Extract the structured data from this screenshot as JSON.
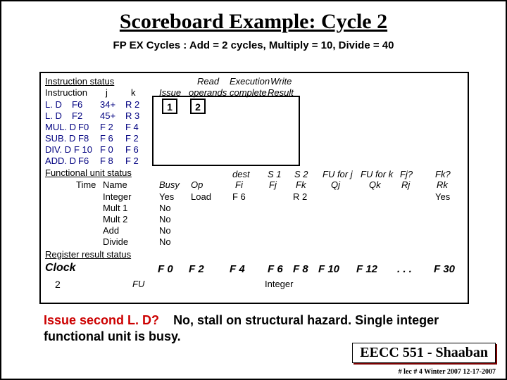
{
  "title": "Scoreboard Example:  Cycle 2",
  "subtitle": "FP EX Cycles :  Add = 2 cycles, Multiply = 10, Divide = 40",
  "labels": {
    "instr_status": "Instruction status",
    "instruction": "Instruction",
    "j": "j",
    "k": "k",
    "issue": "Issue",
    "read": "Read",
    "operands": "operands",
    "execution": "Execution",
    "complete": "complete",
    "write": "Write",
    "result": "Result",
    "func_unit_status": "Functional unit status",
    "time": "Time",
    "name": "Name",
    "busy": "Busy",
    "op": "Op",
    "dest": "dest",
    "fi": "Fi",
    "s1": "S 1",
    "fj": "Fj",
    "s2": "S 2",
    "fk": "Fk",
    "fuj": "FU for j",
    "qj": "Qj",
    "fuk": "FU for k",
    "qk": "Qk",
    "fjq": "Fj?",
    "rj": "Rj",
    "fkq": "Fk?",
    "rk": "Rk",
    "reg_result_status": "Register result status",
    "clock": "Clock",
    "fu": "FU"
  },
  "instr": [
    {
      "op": "L. D",
      "rd": "F6",
      "j": "34+",
      "k": "R 2",
      "issue": "1",
      "read": "2"
    },
    {
      "op": "L. D",
      "rd": "F2",
      "j": "45+",
      "k": "R 3"
    },
    {
      "op": "MUL. D",
      "rd": "F0",
      "j": "F 2",
      "k": "F 4"
    },
    {
      "op": "SUB. D",
      "rd": "F8",
      "j": "F 6",
      "k": "F 2"
    },
    {
      "op": "DIV. D",
      "rd": "F 10",
      "j": "F 0",
      "k": "F 6"
    },
    {
      "op": "ADD. D",
      "rd": "F6",
      "j": "F 8",
      "k": "F 2"
    }
  ],
  "fu": [
    {
      "name": "Integer",
      "busy": "Yes",
      "op": "Load",
      "fi": "F 6",
      "fj": "",
      "fk": "R 2",
      "qj": "",
      "qk": "",
      "rj": "",
      "rk": "Yes"
    },
    {
      "name": "Mult 1",
      "busy": "No"
    },
    {
      "name": "Mult 2",
      "busy": "No"
    },
    {
      "name": "Add",
      "busy": "No"
    },
    {
      "name": "Divide",
      "busy": "No"
    }
  ],
  "clock_val": "2",
  "regs": [
    "F 0",
    "F 2",
    "F 4",
    "F 6",
    "F 8",
    "F 10",
    "F 12",
    ". . .",
    "F 30"
  ],
  "reg_fu": {
    "F 6": "Integer"
  },
  "bottom1": "Issue second L. D?",
  "bottom2": "No, stall on structural hazard.  Single integer functional unit is busy.",
  "course": "EECC 551 - Shaaban",
  "footer": "#  lec # 4  Winter 2007    12-17-2007",
  "chart_data": {
    "type": "table",
    "title": "Scoreboard Example: Cycle 2",
    "constants": {
      "add_cycles": 2,
      "multiply_cycles": 10,
      "divide_cycles": 40
    },
    "clock": 2,
    "instruction_status": {
      "columns": [
        "Instruction",
        "j",
        "k",
        "Issue",
        "Read operands",
        "Execution complete",
        "Write Result"
      ],
      "rows": [
        [
          "L.D F6",
          "34+",
          "R2",
          1,
          2,
          null,
          null
        ],
        [
          "L.D F2",
          "45+",
          "R3",
          null,
          null,
          null,
          null
        ],
        [
          "MUL.D F0",
          "F2",
          "F4",
          null,
          null,
          null,
          null
        ],
        [
          "SUB.D F8",
          "F6",
          "F2",
          null,
          null,
          null,
          null
        ],
        [
          "DIV.D F10",
          "F0",
          "F6",
          null,
          null,
          null,
          null
        ],
        [
          "ADD.D F6",
          "F8",
          "F2",
          null,
          null,
          null,
          null
        ]
      ]
    },
    "functional_unit_status": {
      "columns": [
        "Time",
        "Name",
        "Busy",
        "Op",
        "Fi",
        "Fj",
        "Fk",
        "Qj",
        "Qk",
        "Rj",
        "Rk"
      ],
      "rows": [
        [
          null,
          "Integer",
          "Yes",
          "Load",
          "F6",
          null,
          "R2",
          null,
          null,
          null,
          "Yes"
        ],
        [
          null,
          "Mult1",
          "No",
          null,
          null,
          null,
          null,
          null,
          null,
          null,
          null
        ],
        [
          null,
          "Mult2",
          "No",
          null,
          null,
          null,
          null,
          null,
          null,
          null,
          null
        ],
        [
          null,
          "Add",
          "No",
          null,
          null,
          null,
          null,
          null,
          null,
          null,
          null
        ],
        [
          null,
          "Divide",
          "No",
          null,
          null,
          null,
          null,
          null,
          null,
          null,
          null
        ]
      ]
    },
    "register_result_status": {
      "registers": [
        "F0",
        "F2",
        "F4",
        "F6",
        "F8",
        "F10",
        "F12",
        "...",
        "F30"
      ],
      "FU": [
        null,
        null,
        null,
        "Integer",
        null,
        null,
        null,
        null,
        null
      ]
    },
    "annotation": "Issue second L.D? No, stall on structural hazard. Single integer functional unit is busy."
  }
}
